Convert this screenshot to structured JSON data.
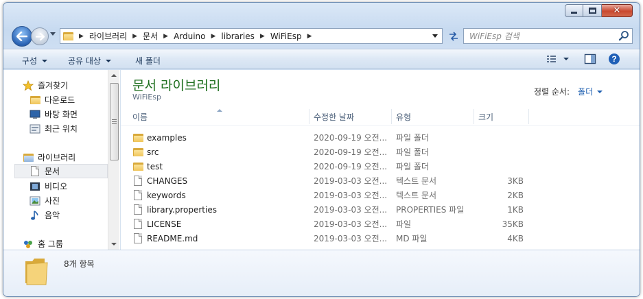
{
  "window": {
    "caption_buttons": {
      "minimize_icon": "minimize-icon",
      "maximize_icon": "maximize-icon",
      "close_icon": "close-icon",
      "close_color": "#c9482f"
    }
  },
  "address": {
    "crumbs": [
      "라이브러리",
      "문서",
      "Arduino",
      "libraries",
      "WiFiEsp"
    ],
    "search_placeholder": "WiFiEsp 검색"
  },
  "toolbar": {
    "organize": "구성",
    "share": "공유 대상",
    "new_folder": "새 폴더"
  },
  "navpane": {
    "favorites": "즐겨찾기",
    "downloads": "다운로드",
    "desktop": "바탕 화면",
    "recent": "최근 위치",
    "libraries": "라이브러리",
    "documents": "문서",
    "videos": "비디오",
    "pictures": "사진",
    "music": "음악",
    "homegroup": "홈 그룹"
  },
  "content": {
    "title": "문서 라이브러리",
    "subtitle": "WiFiEsp",
    "arrange_label": "정렬 순서:",
    "arrange_value": "폴더",
    "columns": {
      "name": "이름",
      "date": "수정한 날짜",
      "type": "유형",
      "size": "크기"
    },
    "files": [
      {
        "name": "examples",
        "date": "2020-09-19 오전...",
        "type": "파일 폴더",
        "size": "",
        "icon": "folder-icon"
      },
      {
        "name": "src",
        "date": "2020-09-19 오전...",
        "type": "파일 폴더",
        "size": "",
        "icon": "folder-icon"
      },
      {
        "name": "test",
        "date": "2020-09-19 오전...",
        "type": "파일 폴더",
        "size": "",
        "icon": "folder-icon"
      },
      {
        "name": "CHANGES",
        "date": "2019-03-03 오전...",
        "type": "텍스트 문서",
        "size": "3KB",
        "icon": "document-icon"
      },
      {
        "name": "keywords",
        "date": "2019-03-03 오전...",
        "type": "텍스트 문서",
        "size": "2KB",
        "icon": "document-icon"
      },
      {
        "name": "library.properties",
        "date": "2019-03-03 오전...",
        "type": "PROPERTIES 파일",
        "size": "1KB",
        "icon": "document-icon"
      },
      {
        "name": "LICENSE",
        "date": "2019-03-03 오전...",
        "type": "파일",
        "size": "35KB",
        "icon": "document-icon"
      },
      {
        "name": "README.md",
        "date": "2019-03-03 오전...",
        "type": "MD 파일",
        "size": "4KB",
        "icon": "document-icon"
      }
    ]
  },
  "details": {
    "count": "8개 항목"
  },
  "colors": {
    "accent": "#1e5fb0",
    "title_green": "#1d6e1d"
  }
}
